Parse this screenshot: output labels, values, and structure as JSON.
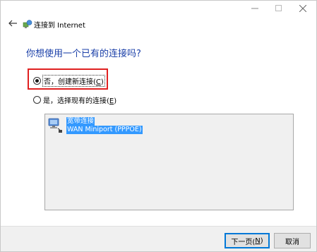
{
  "window": {
    "title": "连接到 Internet",
    "controls": {
      "minimize": "—",
      "maximize": "☐",
      "close": "✕"
    }
  },
  "question": "你想使用一个已有的连接吗?",
  "options": [
    {
      "label_pre": "否，创建新连接(",
      "accel": "C",
      "label_post": ")",
      "checked": true
    },
    {
      "label_pre": "是，选择现有的连接(",
      "accel": "E",
      "label_post": ")",
      "checked": false
    }
  ],
  "connections": [
    {
      "name": "宽带连接",
      "device": "WAN Miniport (PPPOE)",
      "selected": true,
      "icon": "network-computer-icon"
    }
  ],
  "buttons": {
    "next_pre": "下一页(",
    "next_accel": "N",
    "next_post": ")",
    "cancel": "取消"
  },
  "colors": {
    "question": "#1a3fa8",
    "selection": "#3399ff",
    "highlight_box": "#e02020",
    "default_button_border": "#0078d7"
  }
}
